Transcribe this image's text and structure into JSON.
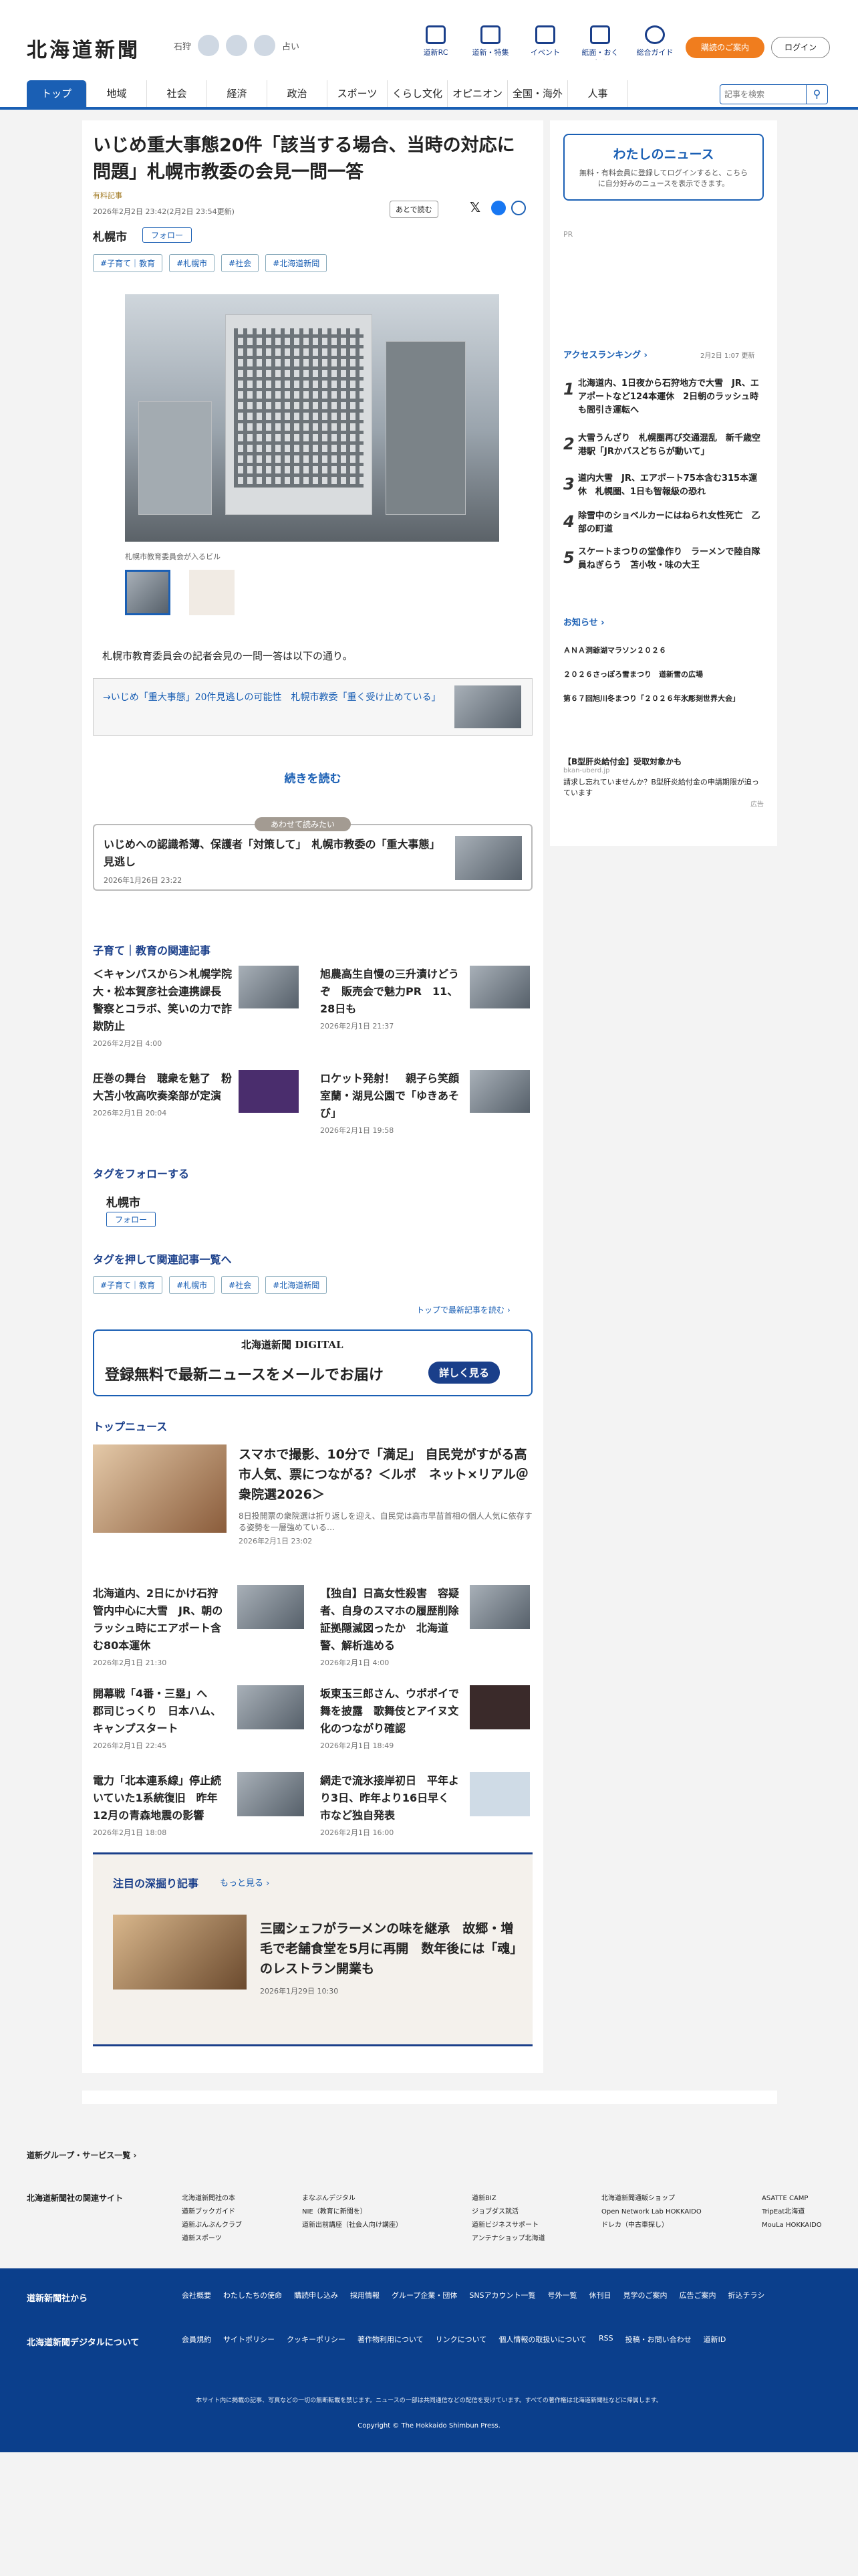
{
  "header": {
    "logo": "北海道新聞",
    "city": "石狩",
    "weather_label": "占い",
    "nav": [
      "道新RC",
      "道新・特集",
      "イベント",
      "紙面・おくやみ",
      "総合ガイド"
    ],
    "btn_signup": "購読のご案内",
    "btn_login": "ログイン"
  },
  "gnav": {
    "tabs": [
      "トップ",
      "地域",
      "社会",
      "経済",
      "政治",
      "スポーツ",
      "くらし文化",
      "オピニオン",
      "全国・海外",
      "人事"
    ],
    "search_placeholder": "記事を検索"
  },
  "article": {
    "title": "いじめ重大事態20件「該当する場合、当時の対応に問題」札幌市教委の会見一問一答",
    "badge": "有料記事",
    "date": "2026年2月2日 23:42(2月2日 23:54更新)",
    "save": "あとで読む",
    "location": "札幌市",
    "follow": "フォロー",
    "tags": [
      "#子育て｜教育",
      "#札幌市",
      "#社会",
      "#北海道新聞"
    ],
    "caption": "札幌市教育委員会が入るビル",
    "lead": "札幌市教育委員会の記者会見の一問一答は以下の通り。",
    "related": "→いじめ「重大事態」20件見逃しの可能性　札幌市教委「重く受け止めている」",
    "more": "続きを読む",
    "also_label": "あわせて読みたい",
    "also_title": "いじめへの認識希薄、保護者「対策して」　札幌市教委の「重大事態」見逃し",
    "also_date": "2026年1月26日 23:22"
  },
  "related_section": {
    "title": "子育て｜教育の関連記事",
    "items": [
      {
        "title": "＜キャンパスから＞札幌学院大・松本賀彦社会連携課長　警察とコラボ、笑いの力で詐欺防止",
        "date": "2026年2月2日 4:00"
      },
      {
        "title": "旭農高生自慢の三升漬けどうぞ　販売会で魅力PR　11、28日も",
        "date": "2026年2月1日 21:37"
      },
      {
        "title": "圧巻の舞台　聴衆を魅了　粉大苫小牧高吹奏楽部が定演",
        "date": "2026年2月1日 20:04"
      },
      {
        "title": "ロケット発射！　親子ら笑顔　室蘭・湖見公園で「ゆきあそび」",
        "date": "2026年2月1日 19:58"
      }
    ]
  },
  "follow_section": {
    "title": "タグをフォローする",
    "tag": "札幌市",
    "btn": "フォロー"
  },
  "taglinks": {
    "title": "タグを押して関連記事一覧へ",
    "tags": [
      "#子育て｜教育",
      "#札幌市",
      "#社会",
      "#北海道新聞"
    ],
    "to_top": "トップで最新記事を読む"
  },
  "banner": {
    "brand": "北海道新聞 DIGITAL",
    "text": "登録無料で最新ニュースをメールでお届け",
    "btn": "詳しく見る"
  },
  "topnews": {
    "title": "トップニュース",
    "lead_title": "スマホで撮影、10分で「満足」 自民党がすがる高市人気、票につながる？＜ルポ　ネット×リアル＠衆院選2026＞",
    "lead_desc": "8日投開票の衆院選は折り返しを迎え、自民党は高市早苗首相の個人人気に依存する姿勢を一層強めている…",
    "lead_date": "2026年2月1日 23:02",
    "items": [
      {
        "title": "北海道内、2日にかけ石狩管内中心に大雪　JR、朝のラッシュ時にエアポート含む80本運休",
        "date": "2026年2月1日 21:30"
      },
      {
        "title": "【独自】日高女性殺害　容疑者、自身のスマホの履歴削除　証拠隠滅図ったか　北海道警、解析進める",
        "date": "2026年2月1日 4:00"
      },
      {
        "title": "開幕戦「4番・三塁」へ　郡司じっくり　日本ハム、キャンプスタート",
        "date": "2026年2月1日 22:45"
      },
      {
        "title": "坂東玉三郎さん、ウポポイで舞を披露　歌舞伎とアイヌ文化のつながり確認",
        "date": "2026年2月1日 18:49"
      },
      {
        "title": "電力「北本連系線」停止続いていた1系統復旧　昨年12月の青森地震の影響",
        "date": "2026年2月1日 18:08"
      },
      {
        "title": "網走で流氷接岸初日　平年より3日、昨年より16日早く　市など独自発表",
        "date": "2026年2月1日 16:00"
      }
    ]
  },
  "deep": {
    "title": "注目の深掘り記事",
    "more": "もっと見る",
    "item": "三國シェフがラーメンの味を継承　故郷・増毛で老舗食堂を5月に再開　数年後には「魂」のレストラン開業も",
    "date": "2026年1月29日 10:30"
  },
  "side": {
    "mynews_title": "わたしのニュース",
    "mynews_text": "無料・有料会員に登録してログインすると、こちらに自分好みのニュースを表示できます。",
    "pr": "PR",
    "ranking_title": "アクセスランキング",
    "ranking_date": "2月2日 1:07 更新",
    "ranking": [
      "北海道内、1日夜から石狩地方で大雪　JR、エアポートなど124本運休　2日朝のラッシュ時も間引き運転へ",
      "大雪うんざり　札幌圏再び交通混乱　新千歳空港駅「JRかバスどちらが動いて」",
      "道内大雪　JR、エアポート75本含む315本運休　札幌圏、1日も智報級の恐れ",
      "除雪中のショベルカーにはねられ女性死亡　乙部の町道",
      "スケートまつりの堂像作り　ラーメンで陸自隊員ねぎらう　苫小牧・味の大王"
    ],
    "notice_title": "お知らせ",
    "notices": [
      "ＡＮＡ洞爺湖マラソン２０２６",
      "２０２６さっぽろ雪まつり　道新雪の広場",
      "第６７回旭川冬まつり「２０２６年氷彫刻世界大会」"
    ],
    "ad_title": "【B型肝炎給付金】受取対象かも",
    "ad_src": "bkan-uberd.jp",
    "ad_text": "請求し忘れていませんか？B型肝炎給付金の申請期限が迫っています",
    "ad_label": "広告"
  },
  "footer": {
    "group": "道新グループ・サービス一覧",
    "related_label": "北海道新聞社の関連サイト",
    "cols": [
      [
        "北海道新聞社の本",
        "道新ブックガイド",
        "道新ぶんぶんクラブ",
        "道新スポーツ"
      ],
      [
        "まなぶんデジタル",
        "NIE（教育に新聞を）",
        "道新出前講座（社会人向け講座）"
      ],
      [
        "道新BIZ",
        "ジョブダス就活",
        "道新ビジネスサポート",
        "アンテナショップ北海道"
      ],
      [
        "北海道新聞通販ショップ",
        "Open Network Lab HOKKAIDO",
        "ドレカ（中古車探し）"
      ],
      [
        "ASATTE CAMP",
        "TripEat北海道",
        "MouLa HOKKAIDO"
      ]
    ],
    "company_label": "道新新聞社から",
    "company_links": [
      "会社概要",
      "わたしたちの使命",
      "購読申し込み",
      "採用情報",
      "グループ企業・団体",
      "SNSアカウント一覧",
      "号外一覧",
      "休刊日",
      "見学のご案内",
      "広告ご案内",
      "折込チラシ"
    ],
    "digital_label": "北海道新聞デジタルについて",
    "digital_links": [
      "会員規約",
      "サイトポリシー",
      "クッキーポリシー",
      "著作物利用について",
      "リンクについて",
      "個人情報の取扱いについて",
      "RSS",
      "投稿・お問い合わせ",
      "道新ID"
    ],
    "notice": "本サイト内に掲載の記事、写真などの一切の無断転載を禁じます。ニュースの一部は共同通信などの配信を受けています。すべての著作権は北海道新聞社などに帰属します。",
    "copyright": "Copyright © The Hokkaido Shimbun Press."
  }
}
